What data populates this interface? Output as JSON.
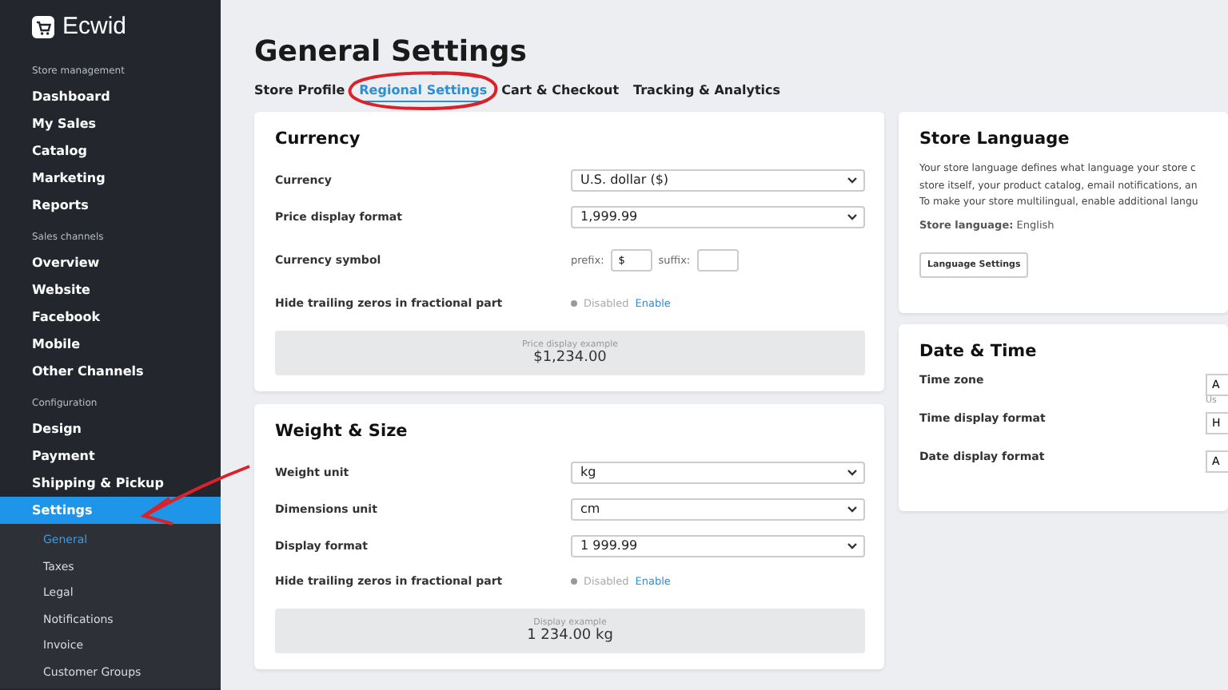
{
  "sidebar": {
    "logo": "Ecwid",
    "sections": [
      {
        "heading": "Store management",
        "items": [
          {
            "label": "Dashboard",
            "selected": false
          },
          {
            "label": "My Sales",
            "selected": false
          },
          {
            "label": "Catalog",
            "selected": false
          },
          {
            "label": "Marketing",
            "selected": false
          },
          {
            "label": "Reports",
            "selected": false
          }
        ]
      },
      {
        "heading": "Sales channels",
        "items": [
          {
            "label": "Overview",
            "selected": false
          },
          {
            "label": "Website",
            "selected": false
          },
          {
            "label": "Facebook",
            "selected": false
          },
          {
            "label": "Mobile",
            "selected": false
          },
          {
            "label": "Other Channels",
            "selected": false
          }
        ]
      },
      {
        "heading": "Configuration",
        "items": [
          {
            "label": "Design",
            "selected": false
          },
          {
            "label": "Payment",
            "selected": false
          },
          {
            "label": "Shipping & Pickup",
            "selected": false
          },
          {
            "label": "Settings",
            "selected": true,
            "children": [
              {
                "label": "General",
                "selected": true
              },
              {
                "label": "Taxes",
                "selected": false
              },
              {
                "label": "Legal",
                "selected": false
              },
              {
                "label": "Notifications",
                "selected": false
              },
              {
                "label": "Invoice",
                "selected": false
              },
              {
                "label": "Customer Groups",
                "selected": false
              }
            ]
          }
        ]
      }
    ]
  },
  "page": {
    "title": "General Settings",
    "tabs": [
      {
        "label": "Store Profile",
        "selected": false
      },
      {
        "label": "Regional Settings",
        "selected": true
      },
      {
        "label": "Cart & Checkout",
        "selected": false
      },
      {
        "label": "Tracking & Analytics",
        "selected": false
      }
    ]
  },
  "left_cards": [
    {
      "title": "Currency",
      "rows": [
        {
          "kind": "select",
          "label": "Currency",
          "value": "U.S. dollar ($)"
        },
        {
          "kind": "select",
          "label": "Price display format",
          "value": "1,999.99"
        },
        {
          "kind": "symbol",
          "label": "Currency symbol",
          "prefix_label": "prefix:",
          "prefix": "$",
          "suffix_label": "suffix:"
        },
        {
          "kind": "toggle",
          "label": "Hide trailing zeros in fractional part",
          "status": "Disabled",
          "action": "Enable",
          "on": false
        }
      ],
      "example": {
        "caption": "Price display example",
        "value": "$1,234.00"
      }
    },
    {
      "title": "Weight & Size",
      "rows": [
        {
          "kind": "select",
          "label": "Weight unit",
          "value": "kg"
        },
        {
          "kind": "select",
          "label": "Dimensions unit",
          "value": "cm"
        },
        {
          "kind": "select",
          "label": "Display format",
          "value": "1 999.99"
        },
        {
          "kind": "toggle",
          "label": "Hide trailing zeros in fractional part",
          "status": "Disabled",
          "action": "Enable",
          "on": false
        }
      ],
      "example": {
        "caption": "Display example",
        "value": "1 234.00 kg"
      }
    }
  ],
  "store_language": {
    "title": "Store Language",
    "description": [
      "Your store language defines what language your store c",
      "store itself, your product catalog, email notifications, an",
      "To make your store multilingual, enable additional langu"
    ],
    "current_label": "Store language:",
    "current_value": "English",
    "button": "Language Settings"
  },
  "date_time": {
    "title": "Date & Time",
    "rows": [
      {
        "label": "Time zone",
        "value": "A",
        "hint": "Us"
      },
      {
        "label": "Time display format",
        "value": "H"
      },
      {
        "label": "Date display format",
        "value": "A"
      }
    ]
  }
}
